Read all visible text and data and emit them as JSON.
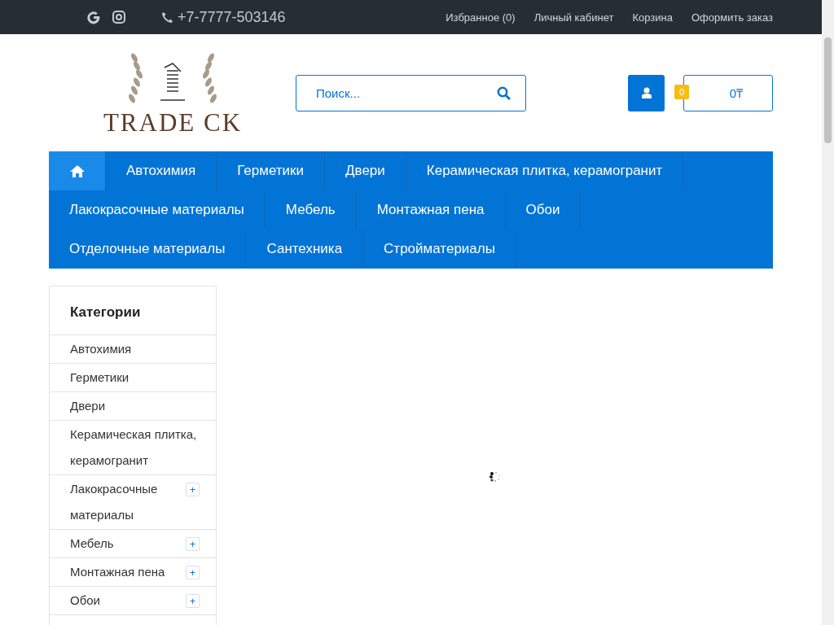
{
  "top_bar": {
    "phone": "+7-7777-503146",
    "links": [
      "Избранное (0)",
      "Личный кабинет",
      "Корзина",
      "Оформить заказ"
    ]
  },
  "header": {
    "logo_text": "TRADE CK",
    "search": {
      "placeholder": "Поиск..."
    },
    "cart": {
      "count": "0",
      "total": "0₸"
    }
  },
  "nav": {
    "items": [
      {
        "kind": "home",
        "selected": true
      },
      {
        "label": "Автохимия",
        "kind": "text",
        "selected": false
      },
      {
        "label": "Герметики",
        "kind": "text",
        "selected": false
      },
      {
        "label": "Двери",
        "kind": "text",
        "selected": false
      },
      {
        "label": "Керамическая плитка, керамогранит",
        "kind": "text",
        "selected": false
      },
      {
        "label": "Лакокрасочные материалы",
        "kind": "text",
        "selected": false
      },
      {
        "label": "Мебель",
        "kind": "text",
        "selected": false
      },
      {
        "label": "Монтажная пена",
        "kind": "text",
        "selected": false
      },
      {
        "label": "Обои",
        "kind": "text",
        "selected": false
      },
      {
        "label": "Отделочные материалы",
        "kind": "text",
        "selected": false
      },
      {
        "label": "Сантехника",
        "kind": "text",
        "selected": false
      },
      {
        "label": "Стройматериалы",
        "kind": "text",
        "selected": false
      }
    ]
  },
  "sidebar": {
    "title": "Категории",
    "items": [
      {
        "label": "Автохимия"
      },
      {
        "label": "Герметики"
      },
      {
        "label": "Двери"
      },
      {
        "label": "Керамическая плитка, керамогранит"
      },
      {
        "label": "Лакокрасочные материалы",
        "toggle": "+"
      },
      {
        "label": "Мебель",
        "toggle": "+"
      },
      {
        "label": "Монтажная пена",
        "toggle": "+"
      },
      {
        "label": "Обои",
        "toggle": "+"
      }
    ]
  }
}
